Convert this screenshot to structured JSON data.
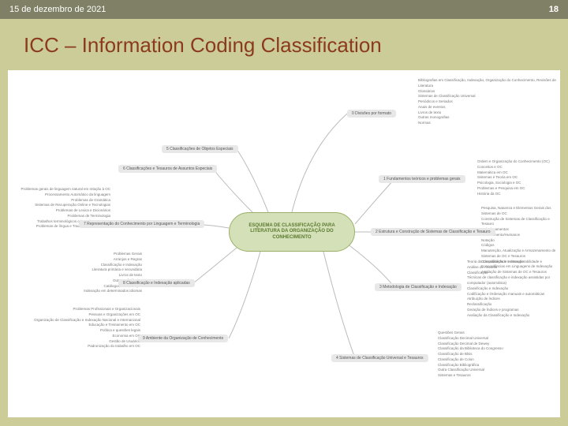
{
  "header": {
    "date": "15 de dezembro de 2021",
    "page": "18"
  },
  "title": "ICC – Information Coding Classification",
  "center": "ESQUEMA DE CLASSIFICAÇÃO PARA LITERATURA DA ORGANIZAÇÃO DO CONHECIMENTO",
  "branches": {
    "b0": "0 Divisões por formato",
    "b1": "1 Fundamentos teóricos e problemas gerais",
    "b2": "2 Estrutura e Construção de Sistemas de Classificação e Tesauro",
    "b3": "3 Metodologia de Classificação e Indexação",
    "b4": "4 Sistemas de Classificação Universal e Tesauros",
    "b5": "5 Classificações de Objetos Especiais",
    "b6": "6 Classificações e Tesauros de Assuntos Especiais",
    "b7": "7 Representação do Conhecimento por Linguagem e Terminologia",
    "b8": "8 Classificação e Indexação aplicadas",
    "b9": "9 Ambiente da Organização de Conhecimento"
  },
  "sub": {
    "s0": [
      "Bibliografias em Classificação, Indexação, Organização do Conhecimento, Revisões de Literatura",
      "Glossários",
      "Sistemas de Classificação Universal",
      "Periódicos e Seriados",
      "Anais de eventos",
      "Livros de texto",
      "Outras monografias",
      "Normas"
    ],
    "s1": [
      "Ordem e Organização do Conhecimento (OC)",
      "Conceitos e OC",
      "Matemática em OC",
      "Sistemas e Teoria em OC",
      "Psicologia, Sociologia e OC",
      "Problemas e Pesquisa em OC",
      "História da OC"
    ],
    "s2": [
      "Pesquisa, Natureza e Elementos Gerais dos Sistemas de OC",
      "Construção de Sistemas de Classificação e Tesauro",
      "Relacionamentos",
      "Numeramento/Humanos",
      "Notação",
      "Códigos",
      "Manutenção, Atualização e Armazenamento de Sistemas de OC e Tesauros",
      "Compatibilidade e Interoperabilidade e Concordâncias em Linguagens de Indexação",
      "Avaliação de Sistemas de OC e Tesauros"
    ],
    "s3": [
      "Teoria da Classificação e Indexação",
      "Análise de Assunto",
      "Classificação",
      "Técnicas de classificação e indexação assistidas por computador (automática)",
      "Classificação e Indexação",
      "Codificação e Ordenação manuais e automáticas",
      "Atribuição de Índices",
      "Reclassificação",
      "Geração de Índices e programas",
      "Avaliação da Classificação e Indexação"
    ],
    "s4": [
      "Questões Gerais",
      "Classificação Decimal Universal",
      "Classificação Decimal de Dewey",
      "Classificação da Biblioteca do Congresso",
      "Classificação de Bliss",
      "Classificação de Colon",
      "Classificação Bibliográfica",
      "Outra Classificação Universal",
      "Sistemas e Tesauros"
    ],
    "s7": [
      "Problemas gerais de linguagem natural em relação à OC",
      "Processamento Automático da linguagem",
      "Problemas de Gramática",
      "Sistemas de Recuperação Online e Tecnologias",
      "Problemas de Lexica e Dicionários",
      "Problemas de Terminologia",
      "Trabalhos terminológicos orientados a assunto",
      "Problemas de língua e Tradução de linguagens"
    ],
    "s8": [
      "Problemas Gerais",
      "Arranjos e Regras",
      "Classificação e Indexação",
      "Literatura primária e secundária",
      "Livros de texto",
      "Outras referências",
      "Catálogos de Indexação",
      "Indexação em determinados Idiomas"
    ],
    "s9": [
      "Problemas Profissionais e Organizacionais",
      "Pessoas e Organizações em OC",
      "Organização de Classificação e Indexação Nacional e Internacional",
      "Educação e Treinamento em OC",
      "Política e questões legais",
      "Economia em OC",
      "Gestão de Usuários",
      "Padronização do trabalho em OC"
    ]
  }
}
